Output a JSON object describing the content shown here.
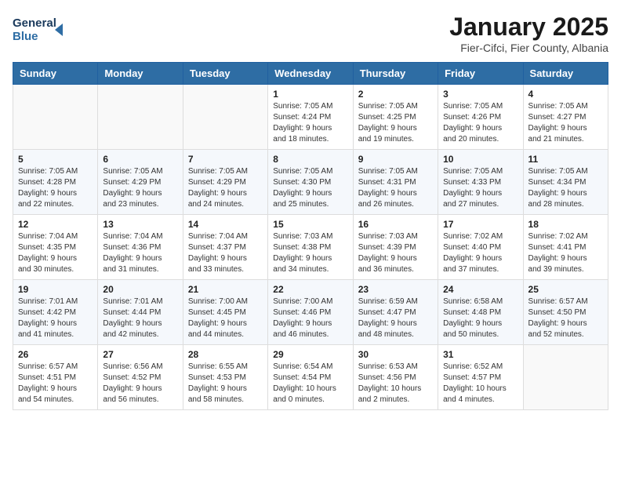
{
  "header": {
    "logo_line1": "General",
    "logo_line2": "Blue",
    "month_title": "January 2025",
    "location": "Fier-Cifci, Fier County, Albania"
  },
  "weekdays": [
    "Sunday",
    "Monday",
    "Tuesday",
    "Wednesday",
    "Thursday",
    "Friday",
    "Saturday"
  ],
  "weeks": [
    [
      {
        "day": "",
        "text": ""
      },
      {
        "day": "",
        "text": ""
      },
      {
        "day": "",
        "text": ""
      },
      {
        "day": "1",
        "text": "Sunrise: 7:05 AM\nSunset: 4:24 PM\nDaylight: 9 hours\nand 18 minutes."
      },
      {
        "day": "2",
        "text": "Sunrise: 7:05 AM\nSunset: 4:25 PM\nDaylight: 9 hours\nand 19 minutes."
      },
      {
        "day": "3",
        "text": "Sunrise: 7:05 AM\nSunset: 4:26 PM\nDaylight: 9 hours\nand 20 minutes."
      },
      {
        "day": "4",
        "text": "Sunrise: 7:05 AM\nSunset: 4:27 PM\nDaylight: 9 hours\nand 21 minutes."
      }
    ],
    [
      {
        "day": "5",
        "text": "Sunrise: 7:05 AM\nSunset: 4:28 PM\nDaylight: 9 hours\nand 22 minutes."
      },
      {
        "day": "6",
        "text": "Sunrise: 7:05 AM\nSunset: 4:29 PM\nDaylight: 9 hours\nand 23 minutes."
      },
      {
        "day": "7",
        "text": "Sunrise: 7:05 AM\nSunset: 4:29 PM\nDaylight: 9 hours\nand 24 minutes."
      },
      {
        "day": "8",
        "text": "Sunrise: 7:05 AM\nSunset: 4:30 PM\nDaylight: 9 hours\nand 25 minutes."
      },
      {
        "day": "9",
        "text": "Sunrise: 7:05 AM\nSunset: 4:31 PM\nDaylight: 9 hours\nand 26 minutes."
      },
      {
        "day": "10",
        "text": "Sunrise: 7:05 AM\nSunset: 4:33 PM\nDaylight: 9 hours\nand 27 minutes."
      },
      {
        "day": "11",
        "text": "Sunrise: 7:05 AM\nSunset: 4:34 PM\nDaylight: 9 hours\nand 28 minutes."
      }
    ],
    [
      {
        "day": "12",
        "text": "Sunrise: 7:04 AM\nSunset: 4:35 PM\nDaylight: 9 hours\nand 30 minutes."
      },
      {
        "day": "13",
        "text": "Sunrise: 7:04 AM\nSunset: 4:36 PM\nDaylight: 9 hours\nand 31 minutes."
      },
      {
        "day": "14",
        "text": "Sunrise: 7:04 AM\nSunset: 4:37 PM\nDaylight: 9 hours\nand 33 minutes."
      },
      {
        "day": "15",
        "text": "Sunrise: 7:03 AM\nSunset: 4:38 PM\nDaylight: 9 hours\nand 34 minutes."
      },
      {
        "day": "16",
        "text": "Sunrise: 7:03 AM\nSunset: 4:39 PM\nDaylight: 9 hours\nand 36 minutes."
      },
      {
        "day": "17",
        "text": "Sunrise: 7:02 AM\nSunset: 4:40 PM\nDaylight: 9 hours\nand 37 minutes."
      },
      {
        "day": "18",
        "text": "Sunrise: 7:02 AM\nSunset: 4:41 PM\nDaylight: 9 hours\nand 39 minutes."
      }
    ],
    [
      {
        "day": "19",
        "text": "Sunrise: 7:01 AM\nSunset: 4:42 PM\nDaylight: 9 hours\nand 41 minutes."
      },
      {
        "day": "20",
        "text": "Sunrise: 7:01 AM\nSunset: 4:44 PM\nDaylight: 9 hours\nand 42 minutes."
      },
      {
        "day": "21",
        "text": "Sunrise: 7:00 AM\nSunset: 4:45 PM\nDaylight: 9 hours\nand 44 minutes."
      },
      {
        "day": "22",
        "text": "Sunrise: 7:00 AM\nSunset: 4:46 PM\nDaylight: 9 hours\nand 46 minutes."
      },
      {
        "day": "23",
        "text": "Sunrise: 6:59 AM\nSunset: 4:47 PM\nDaylight: 9 hours\nand 48 minutes."
      },
      {
        "day": "24",
        "text": "Sunrise: 6:58 AM\nSunset: 4:48 PM\nDaylight: 9 hours\nand 50 minutes."
      },
      {
        "day": "25",
        "text": "Sunrise: 6:57 AM\nSunset: 4:50 PM\nDaylight: 9 hours\nand 52 minutes."
      }
    ],
    [
      {
        "day": "26",
        "text": "Sunrise: 6:57 AM\nSunset: 4:51 PM\nDaylight: 9 hours\nand 54 minutes."
      },
      {
        "day": "27",
        "text": "Sunrise: 6:56 AM\nSunset: 4:52 PM\nDaylight: 9 hours\nand 56 minutes."
      },
      {
        "day": "28",
        "text": "Sunrise: 6:55 AM\nSunset: 4:53 PM\nDaylight: 9 hours\nand 58 minutes."
      },
      {
        "day": "29",
        "text": "Sunrise: 6:54 AM\nSunset: 4:54 PM\nDaylight: 10 hours\nand 0 minutes."
      },
      {
        "day": "30",
        "text": "Sunrise: 6:53 AM\nSunset: 4:56 PM\nDaylight: 10 hours\nand 2 minutes."
      },
      {
        "day": "31",
        "text": "Sunrise: 6:52 AM\nSunset: 4:57 PM\nDaylight: 10 hours\nand 4 minutes."
      },
      {
        "day": "",
        "text": ""
      }
    ]
  ]
}
